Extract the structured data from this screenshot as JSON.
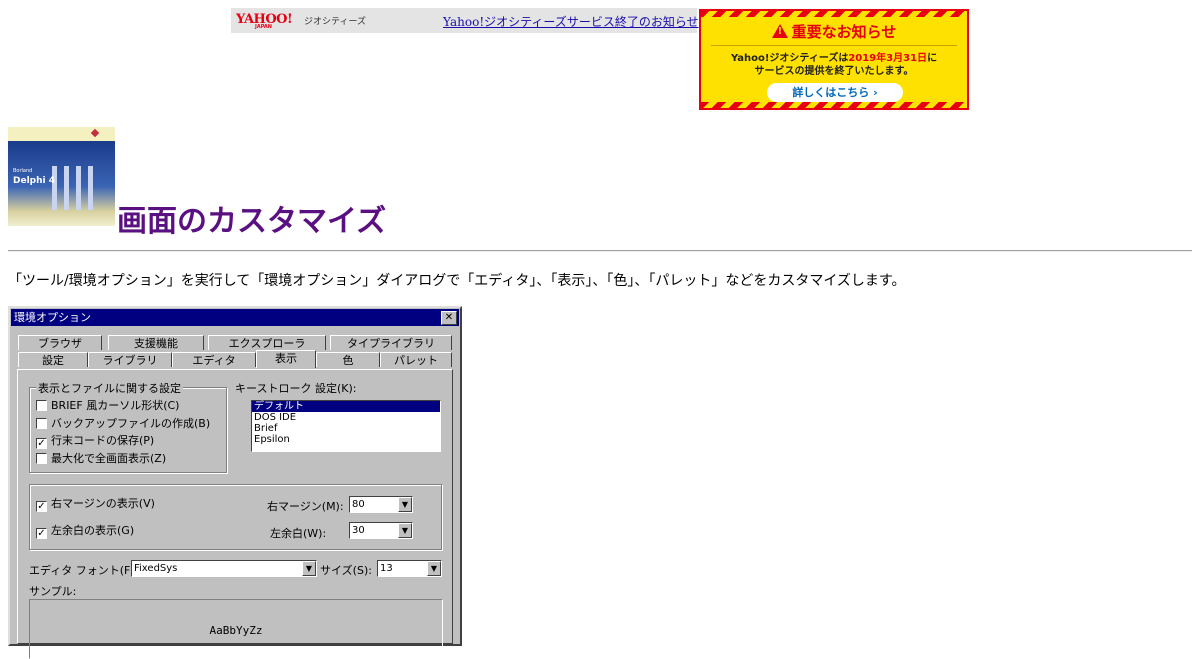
{
  "banner": {
    "logo_text": "YAHOO!",
    "logo_sub": "JAPAN",
    "service_name": "ジオシティーズ",
    "link_text": "Yahoo!ジオシティーズサービス終了のお知らせ"
  },
  "notice": {
    "title": "重要なお知らせ",
    "body_line1_prefix": "Yahoo!ジオシティーズは",
    "body_line1_date": "2019年3月31日",
    "body_line1_suffix": "に",
    "body_line2": "サービスの提供を終了いたします。",
    "button_label": "詳しくはこちら ›",
    "accent_color": "#e60012",
    "background_color": "#ffe100"
  },
  "header": {
    "logo_title": "Delphi 4",
    "logo_brand": "Borland",
    "title": "画面のカスタマイズ",
    "title_color": "#5a1080"
  },
  "intro": "「ツール/環境オプション」を実行して「環境オプション」ダイアログで「エディタ」、「表示」、「色」、「パレット」などをカスタマイズします。",
  "dialog": {
    "title": "環境オプション",
    "close_label": "✕",
    "tabs_row1": [
      "ブラウザ",
      "支援機能",
      "エクスプローラ",
      "タイプライブラリ"
    ],
    "tabs_row2": [
      "設定",
      "ライブラリ",
      "エディタ",
      "表示",
      "色",
      "パレット"
    ],
    "active_tab": "表示",
    "display_group": {
      "label": "表示とファイルに関する設定",
      "options": [
        {
          "label": "BRIEF 風カーソル形状(C)",
          "checked": false,
          "mark": ""
        },
        {
          "label": "バックアップファイルの作成(B)",
          "checked": false,
          "mark": ""
        },
        {
          "label": "行末コードの保存(P)",
          "checked": true,
          "mark": "✓"
        },
        {
          "label": "最大化で全画面表示(Z)",
          "checked": false,
          "mark": ""
        }
      ]
    },
    "keystroke": {
      "label": "キーストローク 設定(K):",
      "items": [
        "デフォルト",
        "DOS IDE",
        "Brief",
        "Epsilon"
      ],
      "selected": "デフォルト"
    },
    "margin": {
      "right_margin_check": "右マージンの表示(V)",
      "right_margin_mark": "✓",
      "left_gutter_check": "左余白の表示(G)",
      "left_gutter_mark": "✓",
      "right_margin_label": "右マージン(M):",
      "right_margin_value": "80",
      "left_gutter_label": "左余白(W):",
      "left_gutter_value": "30"
    },
    "font": {
      "label": "エディタ フォント(F):",
      "value": "FixedSys",
      "size_label": "サイズ(S):",
      "size_value": "13",
      "sample_label": "サンプル:",
      "sample_text": "AaBbYyZz"
    },
    "dropdown_arrow": "▼"
  }
}
